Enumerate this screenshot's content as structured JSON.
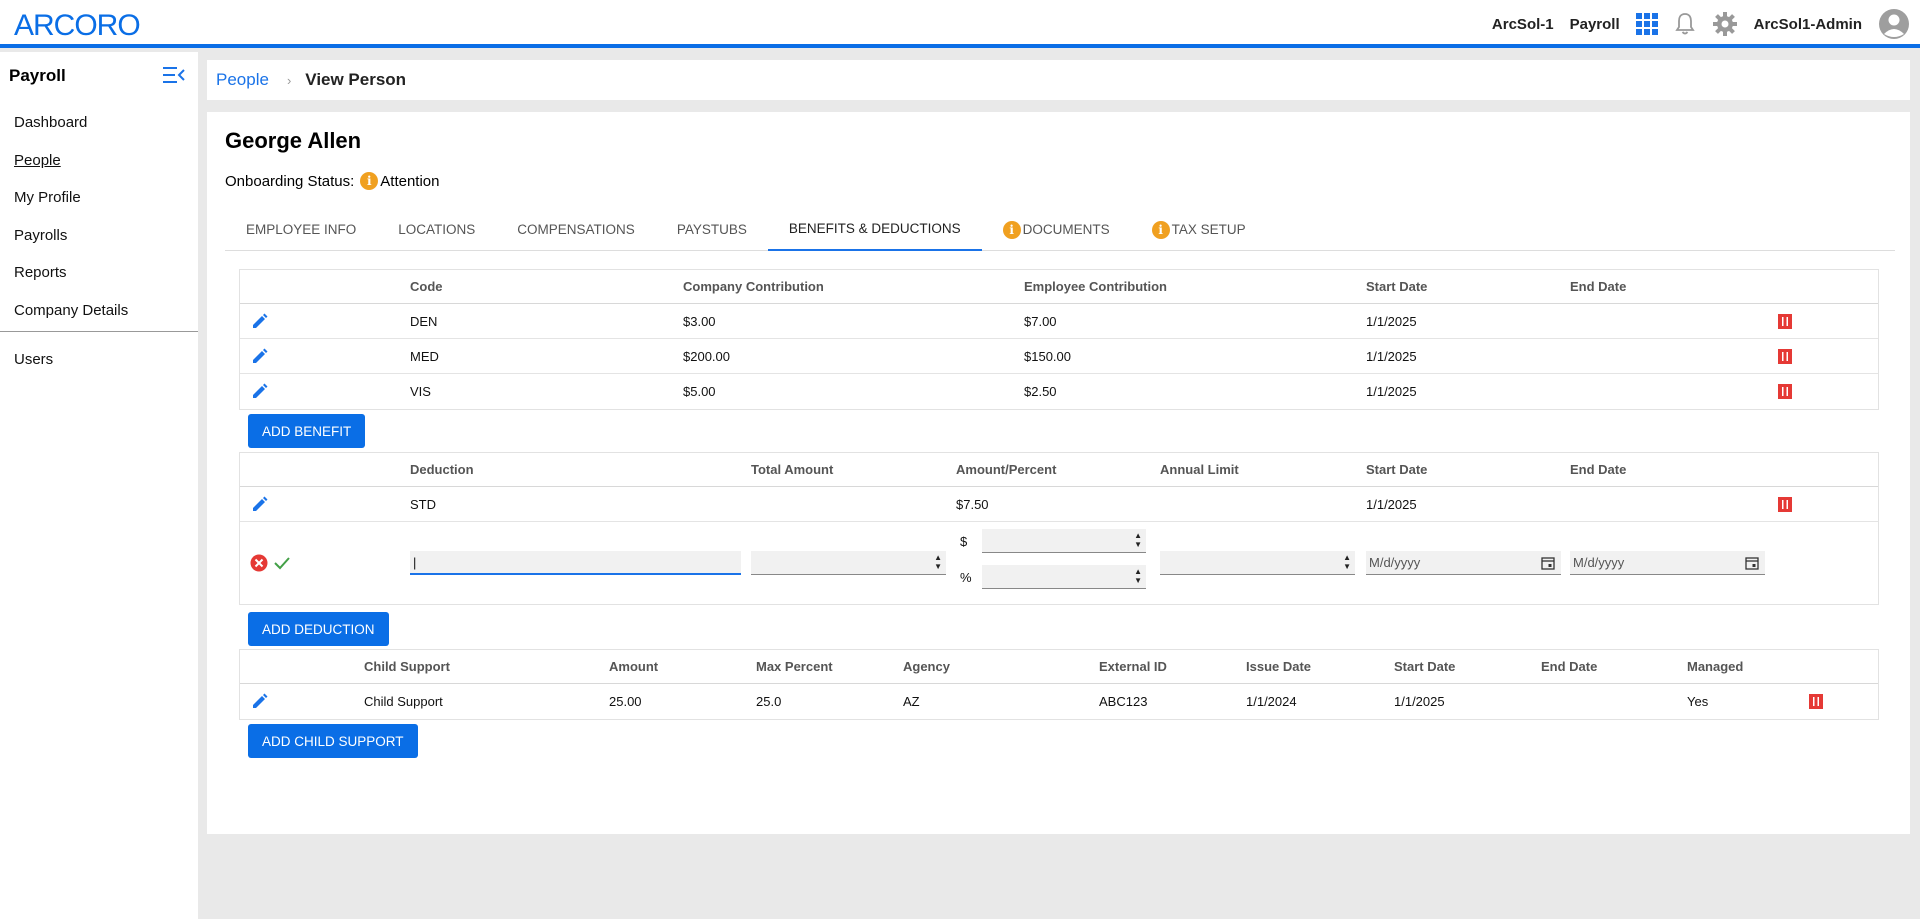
{
  "brand": {
    "logo_text": "ARCORO",
    "accent": "#0a6ee6"
  },
  "topbar": {
    "company": "ArcSol-1",
    "module": "Payroll",
    "user": "ArcSol1-Admin",
    "icons": [
      "apps-grid-icon",
      "bell-icon",
      "gear-icon",
      "user-avatar-icon"
    ]
  },
  "sidebar": {
    "title": "Payroll",
    "items": [
      {
        "label": "Dashboard"
      },
      {
        "label": "People"
      },
      {
        "label": "My Profile"
      },
      {
        "label": "Payrolls"
      },
      {
        "label": "Reports"
      },
      {
        "label": "Company Details"
      }
    ],
    "secondary": [
      {
        "label": "Users"
      }
    ]
  },
  "breadcrumb": {
    "parent": "People",
    "separator": "›",
    "current": "View Person"
  },
  "person": {
    "name": "George Allen",
    "onboarding_label": "Onboarding Status:",
    "onboarding_value": "Attention"
  },
  "tabs": [
    {
      "label": "EMPLOYEE INFO"
    },
    {
      "label": "LOCATIONS"
    },
    {
      "label": "COMPENSATIONS"
    },
    {
      "label": "PAYSTUBS"
    },
    {
      "label": "BENEFITS & DEDUCTIONS"
    },
    {
      "label": "DOCUMENTS"
    },
    {
      "label": "TAX SETUP"
    }
  ],
  "benefits": {
    "headers": [
      "Code",
      "Company Contribution",
      "Employee Contribution",
      "Start Date",
      "End Date"
    ],
    "rows": [
      [
        "DEN",
        "$3.00",
        "$7.00",
        "1/1/2025",
        ""
      ],
      [
        "MED",
        "$200.00",
        "$150.00",
        "1/1/2025",
        ""
      ],
      [
        "VIS",
        "$5.00",
        "$2.50",
        "1/1/2025",
        ""
      ]
    ],
    "add_label": "ADD BENEFIT"
  },
  "deductions": {
    "headers": [
      "Deduction",
      "Total Amount",
      "Amount/Percent",
      "Annual Limit",
      "Start Date",
      "End Date"
    ],
    "rows": [
      [
        "STD",
        "",
        "$7.50",
        "",
        "1/1/2025",
        ""
      ]
    ],
    "edit": {
      "dollar_label": "$",
      "percent_label": "%",
      "deduction_value": "|",
      "start_placeholder": "M/d/yyyy",
      "end_placeholder": "M/d/yyyy"
    },
    "add_label": "ADD DEDUCTION"
  },
  "child_support": {
    "headers": [
      "Child Support",
      "Amount",
      "Max Percent",
      "Agency",
      "External ID",
      "Issue Date",
      "Start Date",
      "End Date",
      "Managed"
    ],
    "rows": [
      [
        "Child Support",
        "25.00",
        "25.0",
        "AZ",
        "ABC123",
        "1/1/2024",
        "1/1/2025",
        "",
        "Yes"
      ]
    ],
    "add_label": "ADD CHILD SUPPORT"
  }
}
